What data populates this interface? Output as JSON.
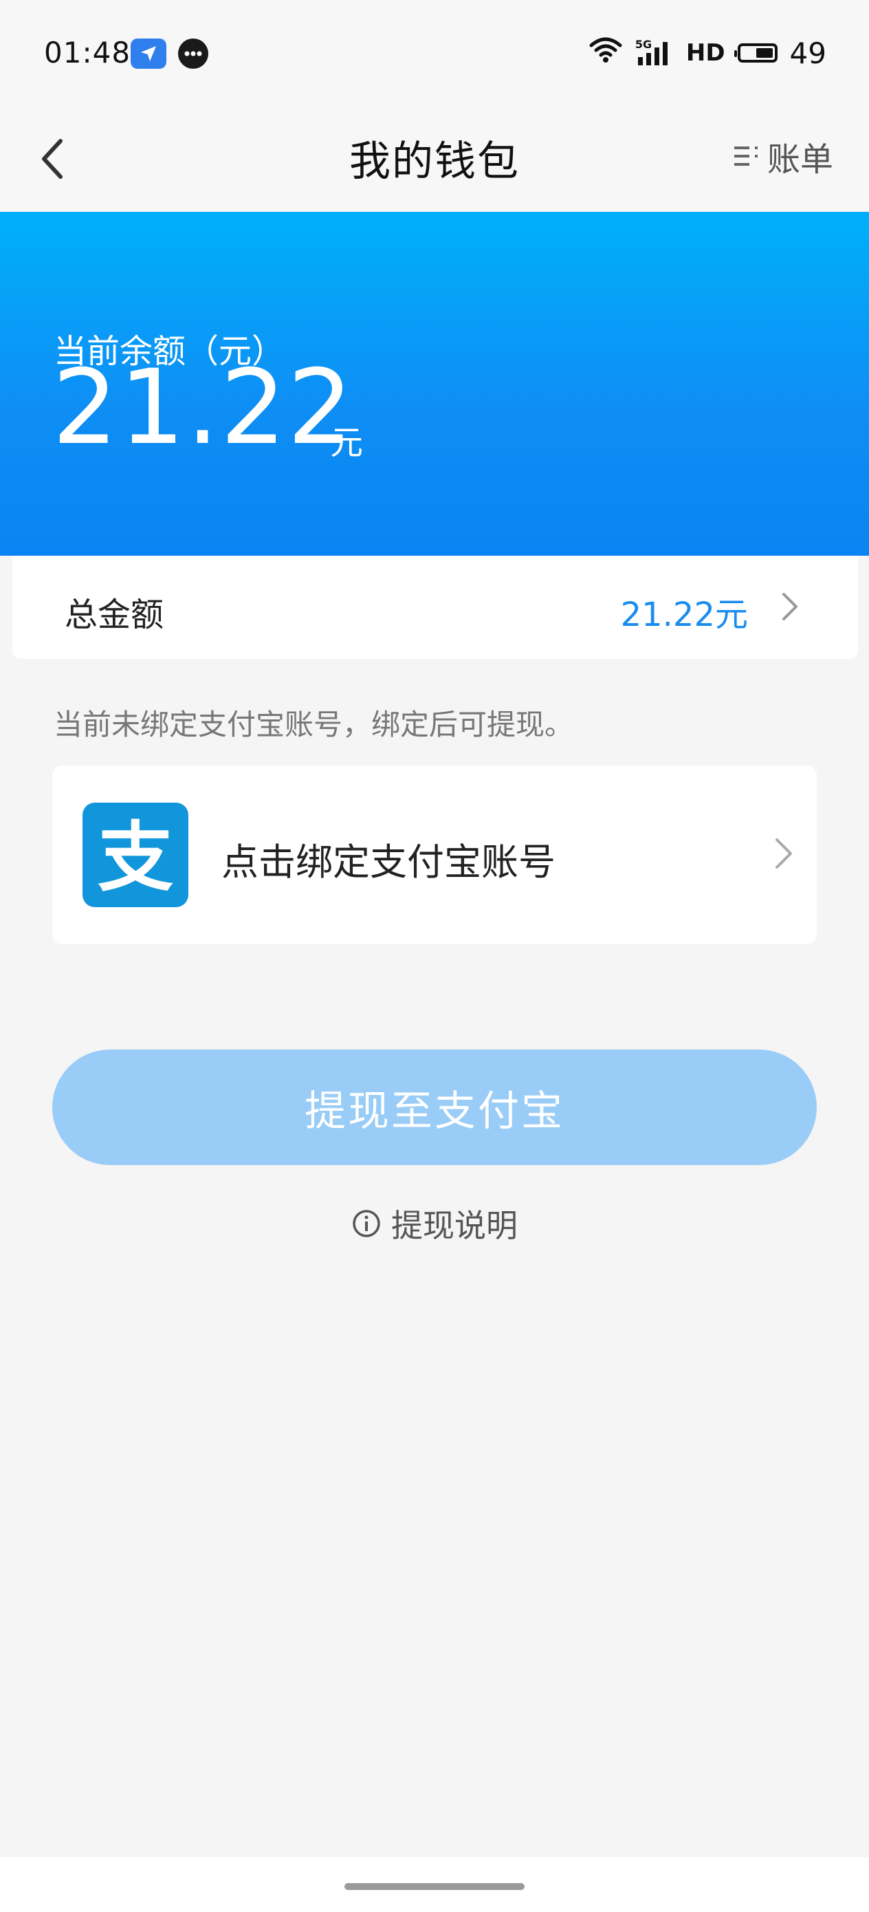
{
  "status_bar": {
    "time": "01:48",
    "network": "5G",
    "hd": "HD",
    "battery": "49"
  },
  "header": {
    "title": "我的钱包",
    "bill_label": "账单",
    "icons": [
      "back-icon",
      "list-icon"
    ]
  },
  "balance": {
    "label": "当前余额（元）",
    "value": "21.22",
    "unit": "元"
  },
  "total": {
    "label": "总金额",
    "value": "21.22元"
  },
  "bind_hint": "当前未绑定支付宝账号，绑定后可提现。",
  "alipay": {
    "label": "点击绑定支付宝账号",
    "logo_glyph": "支"
  },
  "withdraw_button": "提现至支付宝",
  "withdraw_info": "提现说明",
  "colors": {
    "accent": "#1a8cf0",
    "banner_top": "#00b0fb",
    "banner_bottom": "#0a84f2",
    "button_disabled": "#99ccf7",
    "alipay_blue": "#1296db"
  }
}
